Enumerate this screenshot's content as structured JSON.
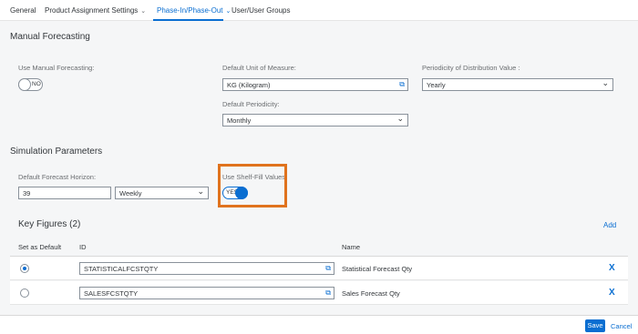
{
  "tabs": [
    {
      "label": "General",
      "has_menu": false
    },
    {
      "label": "Product Assignment Settings",
      "has_menu": true
    },
    {
      "label": "Phase-In/Phase-Out",
      "has_menu": true
    },
    {
      "label": "User/User Groups",
      "has_menu": false
    }
  ],
  "active_tab": "Phase-In/Phase-Out",
  "manual_forecasting": {
    "title": "Manual Forecasting",
    "use_manual_label": "Use Manual Forecasting:",
    "use_manual_state": "NO",
    "uom_label": "Default Unit of Measure:",
    "uom_value": "KG (Kilogram)",
    "periodicity_label": "Default Periodicity:",
    "periodicity_value": "Monthly",
    "dist_label": "Periodicity of Distribution Value :",
    "dist_value": "Yearly"
  },
  "simulation": {
    "title": "Simulation Parameters",
    "horizon_label": "Default Forecast Horizon:",
    "horizon_value": "39",
    "horizon_unit": "Weekly",
    "shelf_fill_label": "Use Shelf-Fill Values:",
    "shelf_fill_state": "YES"
  },
  "key_figures": {
    "title": "Key Figures (2)",
    "add_label": "Add",
    "columns": [
      "Set as Default",
      "ID",
      "Name"
    ],
    "rows": [
      {
        "default": true,
        "id": "STATISTICALFCSTQTY",
        "name": "Statistical Forecast Qty"
      },
      {
        "default": false,
        "id": "SALESFCSTQTY",
        "name": "Sales Forecast Qty"
      }
    ],
    "delete_glyph": "X"
  },
  "footer": {
    "save_label": "Save",
    "cancel_label": "Cancel"
  },
  "colors": {
    "accent": "#0a6ed1",
    "highlight": "#e0731e"
  }
}
